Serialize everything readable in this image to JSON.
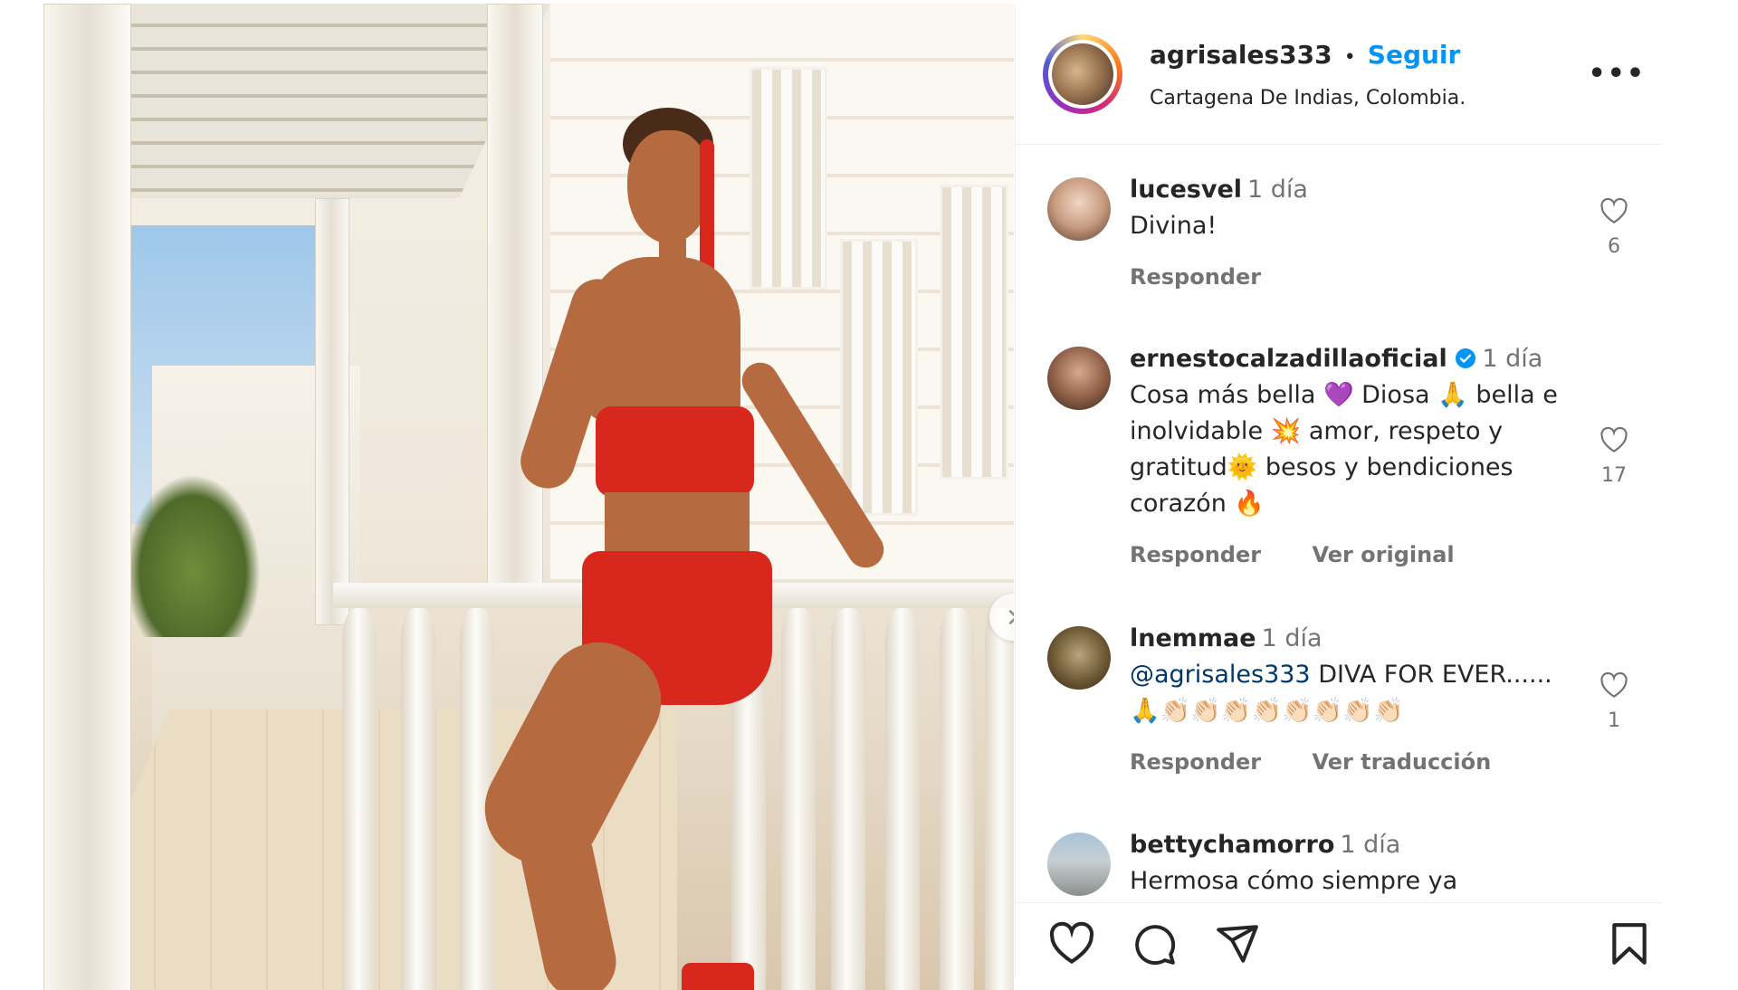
{
  "post": {
    "username": "agrisales333",
    "separator": "•",
    "follow_label": "Seguir",
    "location": "Cartagena De Indias, Colombia.",
    "more_label": "•••"
  },
  "comments": [
    {
      "user": "lucesvel",
      "time": "1 día",
      "lines": [
        "Divina!"
      ],
      "likes": "6",
      "actions": [
        "Responder"
      ]
    },
    {
      "user": "ernestocalzadillaoficial",
      "verified": true,
      "time": "1 día",
      "lines": [
        "Cosa más bella 💜 Diosa 🙏 bella e",
        "inolvidable 💥 amor, respeto y",
        "gratitud🌞 besos y bendiciones",
        "corazón 🔥"
      ],
      "likes": "17",
      "actions": [
        "Responder",
        "Ver original"
      ]
    },
    {
      "user": "lnemmae",
      "time": "1 día",
      "mention": "@agrisales333",
      "lines": [
        " DIVA FOR EVER......",
        "🙏👏🏻👏🏻👏🏻👏🏻👏🏻👏🏻👏🏻👏🏻"
      ],
      "likes": "1",
      "actions": [
        "Responder",
        "Ver traducción"
      ]
    },
    {
      "user": "bettychamorro",
      "time": "1 día",
      "lines": [
        "Hermosa cómo siempre ya"
      ]
    }
  ],
  "icons": {
    "like": "heart-icon",
    "comment": "comment-icon",
    "share": "paper-plane-icon",
    "save": "bookmark-icon",
    "next": "chevron-right-icon"
  },
  "colors": {
    "follow": "#0095f6",
    "verified": "#0095f6",
    "ring": "instagram-gradient"
  }
}
